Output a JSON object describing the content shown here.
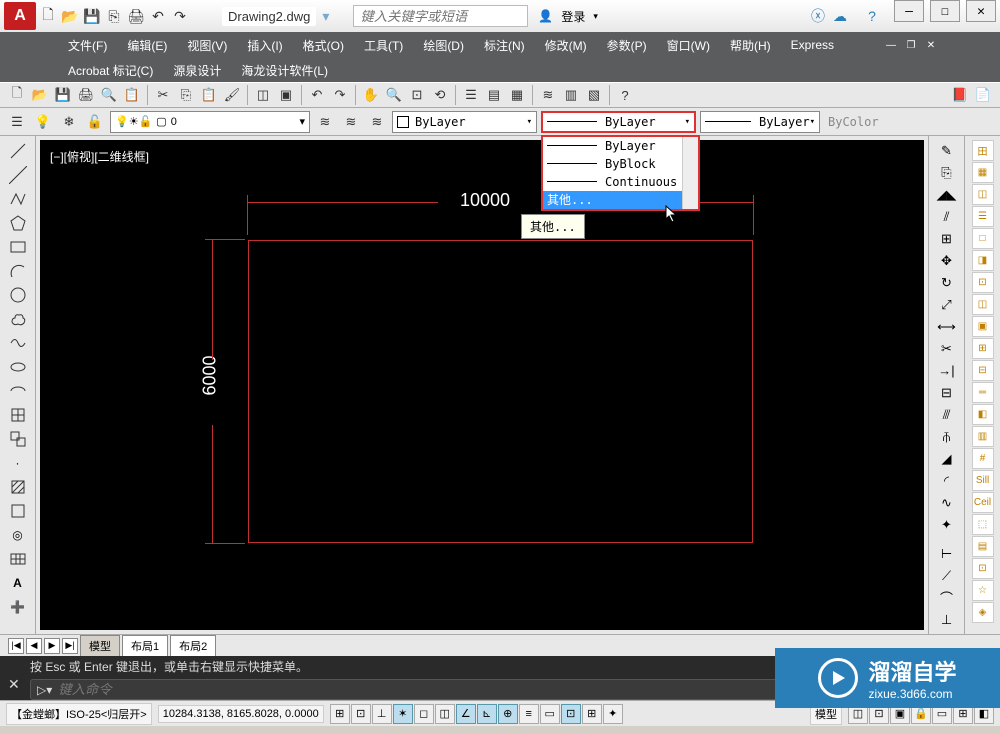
{
  "titlebar": {
    "doc_title": "Drawing2.dwg",
    "search_placeholder": "键入关键字或短语",
    "login_label": "登录"
  },
  "menus": {
    "row1": [
      "文件(F)",
      "编辑(E)",
      "视图(V)",
      "插入(I)",
      "格式(O)",
      "工具(T)",
      "绘图(D)",
      "标注(N)",
      "修改(M)",
      "参数(P)",
      "窗口(W)",
      "帮助(H)",
      "Express"
    ],
    "row2": [
      "Acrobat 标记(C)",
      "源泉设计",
      "海龙设计软件(L)"
    ]
  },
  "props": {
    "layer_current": "0",
    "color_label": "ByLayer",
    "linetype_label": "ByLayer",
    "lineweight_label": "ByLayer",
    "plotstyle_label": "ByColor"
  },
  "linetype_dropdown": {
    "items": [
      {
        "label": "ByLayer"
      },
      {
        "label": "ByBlock"
      },
      {
        "label": "Continuous"
      },
      {
        "label": "其他..."
      }
    ],
    "highlighted_index": 3,
    "tooltip": "其他..."
  },
  "drawing": {
    "view_label": "[−][俯视][二维线框]",
    "dim_horizontal": "10000",
    "dim_vertical": "6000"
  },
  "tabs": {
    "nav": [
      "|◀",
      "◀",
      "▶",
      "▶|"
    ],
    "items": [
      "模型",
      "布局1",
      "布局2"
    ],
    "active_index": 0
  },
  "cmd": {
    "hint": "按 Esc 或 Enter 键退出，或单击右键显示快捷菜单。",
    "prompt_placeholder": "键入命令"
  },
  "status": {
    "dimstyle": "【金螳螂】ISO-25<归层开>",
    "coords": "10284.3138, 8165.8028, 0.0000",
    "model_label": "模型"
  },
  "watermark": {
    "title": "溜溜自学",
    "url": "zixue.3d66.com"
  }
}
